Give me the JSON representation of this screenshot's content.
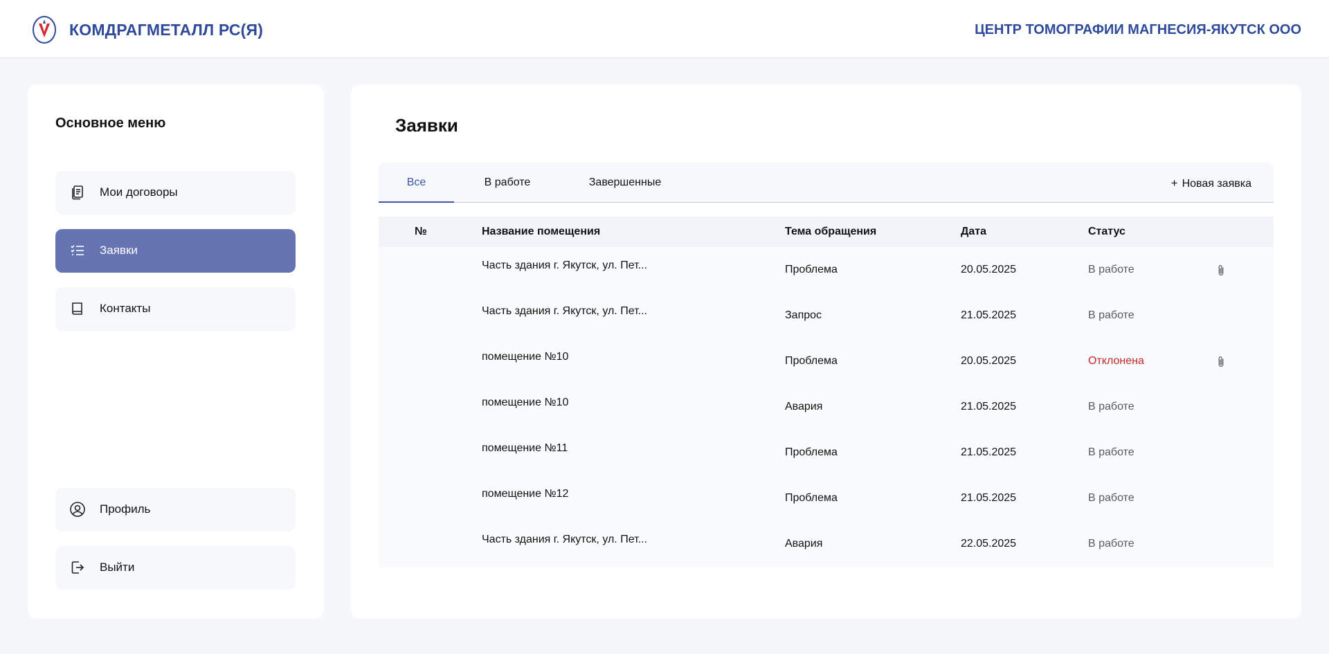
{
  "header": {
    "brand": "КОМДРАГМЕТАЛЛ РС(Я)",
    "organization": "ЦЕНТР ТОМОГРАФИИ МАГНЕСИЯ-ЯКУТСК ООО"
  },
  "sidebar": {
    "title": "Основное меню",
    "items": [
      {
        "label": "Мои договоры",
        "icon": "documents-icon"
      },
      {
        "label": "Заявки",
        "icon": "checklist-icon",
        "active": true
      },
      {
        "label": "Контакты",
        "icon": "book-icon"
      }
    ],
    "bottom_items": [
      {
        "label": "Профиль",
        "icon": "user-circle-icon"
      },
      {
        "label": "Выйти",
        "icon": "logout-icon"
      }
    ]
  },
  "main": {
    "title": "Заявки",
    "tabs": [
      {
        "label": "Все",
        "active": true
      },
      {
        "label": "В работе"
      },
      {
        "label": "Завершенные"
      }
    ],
    "new_button": "Новая заявка",
    "table": {
      "columns": [
        "№",
        "Название помещения",
        "Тема обращения",
        "Дата",
        "Статус"
      ],
      "rows": [
        {
          "name": "Часть здания г. Якутск, ул. Пет...",
          "topic": "Проблема",
          "date": "20.05.2025",
          "status": "В работе",
          "attachment": true
        },
        {
          "name": "Часть здания г. Якутск, ул. Пет...",
          "topic": "Запрос",
          "date": "21.05.2025",
          "status": "В работе",
          "attachment": false
        },
        {
          "name": "помещение №10",
          "topic": "Проблема",
          "date": "20.05.2025",
          "status": "Отклонена",
          "attachment": true
        },
        {
          "name": "помещение №10",
          "topic": "Авария",
          "date": "21.05.2025",
          "status": "В работе",
          "attachment": false
        },
        {
          "name": "помещение №11",
          "topic": "Проблема",
          "date": "21.05.2025",
          "status": "В работе",
          "attachment": false
        },
        {
          "name": "помещение №12",
          "topic": "Проблема",
          "date": "21.05.2025",
          "status": "В работе",
          "attachment": false
        },
        {
          "name": "Часть здания г. Якутск, ул. Пет...",
          "topic": "Авария",
          "date": "22.05.2025",
          "status": "В работе",
          "attachment": false
        }
      ]
    }
  },
  "colors": {
    "brand": "#2f4a9a",
    "active_nav": "#6675b1",
    "declined": "#c0282d"
  }
}
